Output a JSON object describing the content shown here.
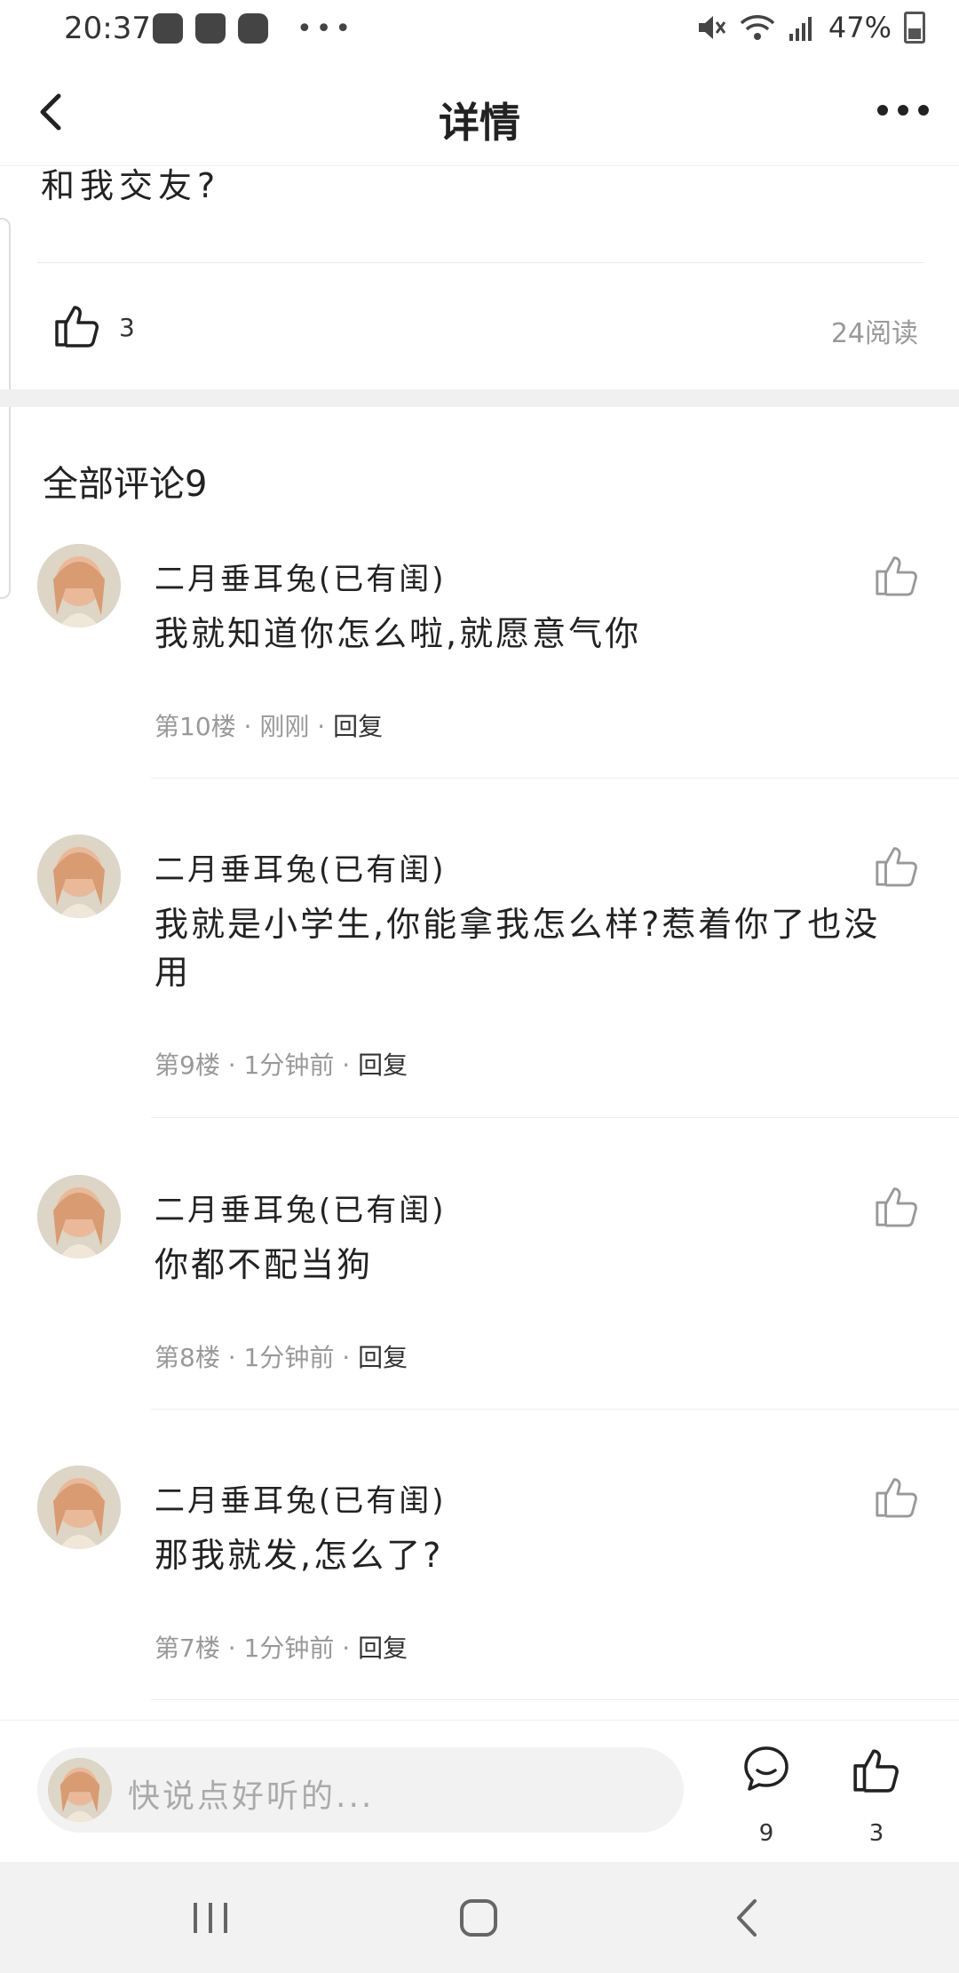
{
  "status_bar": {
    "time": "20:37",
    "battery": "47%"
  },
  "header": {
    "title": "详情"
  },
  "post": {
    "tail_text": "和我交友?",
    "like_count": "3",
    "views": "24阅读"
  },
  "comments_section": {
    "title": "全部评论9"
  },
  "comments": [
    {
      "name": "二月垂耳兔(已有闺)",
      "text": "我就知道你怎么啦,就愿意气你",
      "floor": "第10楼",
      "time": "刚刚",
      "reply": "回复"
    },
    {
      "name": "二月垂耳兔(已有闺)",
      "text": "我就是小学生,你能拿我怎么样?惹着你了也没用",
      "floor": "第9楼",
      "time": "1分钟前",
      "reply": "回复"
    },
    {
      "name": "二月垂耳兔(已有闺)",
      "text": "你都不配当狗",
      "floor": "第8楼",
      "time": "1分钟前",
      "reply": "回复"
    },
    {
      "name": "二月垂耳兔(已有闺)",
      "text": "那我就发,怎么了?",
      "floor": "第7楼",
      "time": "1分钟前",
      "reply": "回复"
    }
  ],
  "bottom_bar": {
    "placeholder": "快说点好听的...",
    "comment_count": "9",
    "like_count": "3"
  },
  "icons": {
    "back": "chevron-left-icon",
    "more": "more-dots-icon",
    "like": "thumbs-up-icon",
    "comment": "chat-bubble-icon",
    "nav_recents": "recents-icon",
    "nav_home": "home-icon",
    "nav_back": "back-icon"
  }
}
